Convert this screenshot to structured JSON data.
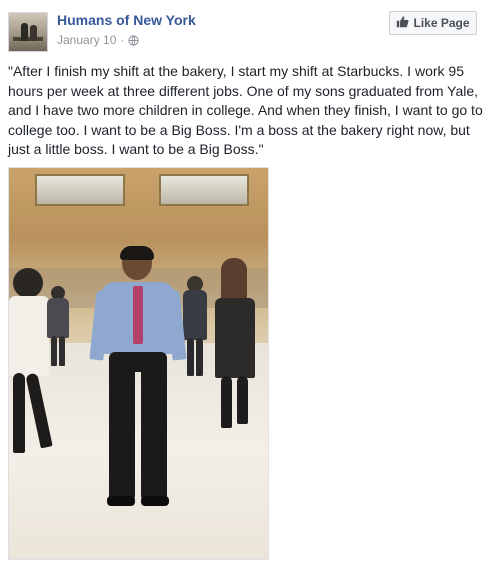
{
  "post": {
    "page_name": "Humans of New York",
    "date": "January 10",
    "separator": "·",
    "privacy_icon": "globe-icon",
    "like_button_label": "Like Page",
    "like_icon": "thumbs-up-icon",
    "caption": "\"After I finish my shift at the bakery, I start my shift at Starbucks. I work 95 hours per week at three different jobs. One of my sons graduated from Yale, and I have two more children in college. And when they finish, I want to go to college too. I want to be a Big Boss. I'm a boss at the bakery right now, but just a little boss. I want to be a Big Boss.\""
  },
  "colors": {
    "page_name": "#365899",
    "meta_text": "#90949c",
    "body_text": "#1d2129",
    "button_bg": "#f6f7f9",
    "button_border": "#ced0d4",
    "button_text": "#4b4f56"
  }
}
